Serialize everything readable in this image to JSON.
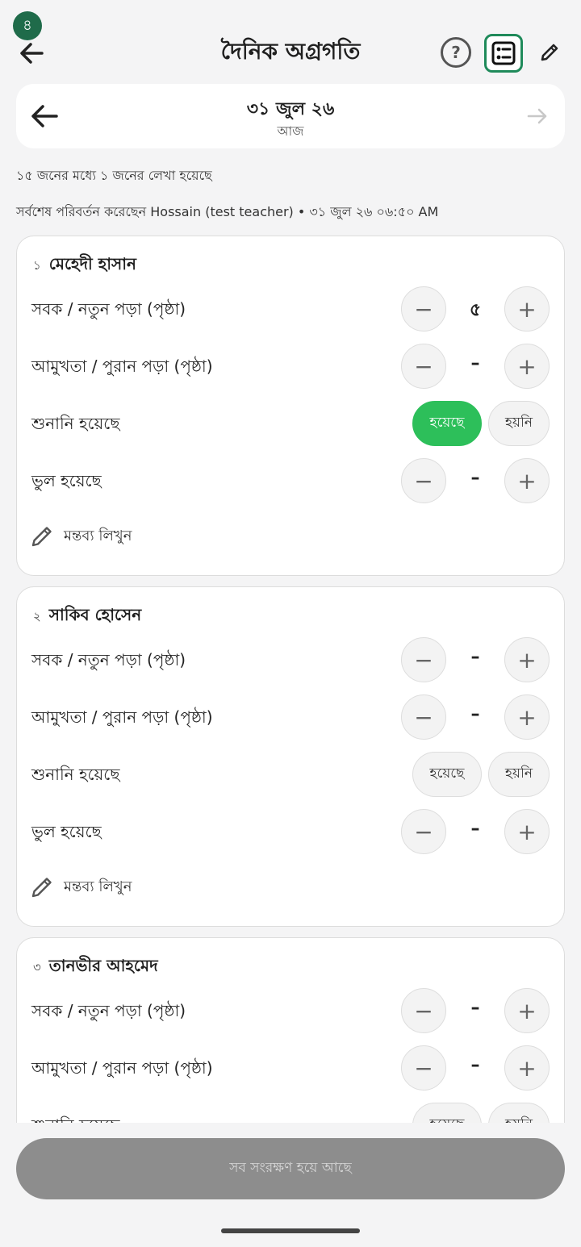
{
  "header": {
    "badge": "৪",
    "title": "দৈনিক অগ্রগতি",
    "help_label": "?"
  },
  "date": {
    "main": "৩১ জুল ২৬",
    "sub": "আজ"
  },
  "summary": "১৫ জনের মধ্যে ১ জনের লেখা হয়েছে",
  "last_modified": "সর্বশেষ পরিবর্তন করেছেন Hossain (test teacher) • ৩১ জুল ২৬ ০৬:৫০ AM",
  "labels": {
    "lesson": "সবক / নতুন পড়া (পৃষ্ঠা)",
    "revision": "আমুখতা / পুরান পড়া (পৃষ্ঠা)",
    "recited": "শুনানি হয়েছে",
    "mistakes": "ভুল হয়েছে",
    "yes": "হয়েছে",
    "no": "হয়নি",
    "comment": "মন্তব্য লিখুন",
    "minus": "−",
    "plus": "+"
  },
  "students": [
    {
      "num": "১",
      "name": "মেহেদী হাসান",
      "lesson": "৫",
      "revision": "–",
      "recited": "yes",
      "mistakes": "–"
    },
    {
      "num": "২",
      "name": "সাকিব হোসেন",
      "lesson": "–",
      "revision": "–",
      "recited": "",
      "mistakes": "–"
    },
    {
      "num": "৩",
      "name": "তানভীর আহমেদ",
      "lesson": "–",
      "revision": "–",
      "recited": "",
      "mistakes": "–"
    }
  ],
  "save_button": "সব সংরক্ষণ হয়ে আছে",
  "colors": {
    "accent": "#2dbf5a",
    "brand": "#1f6b4a",
    "save_disabled": "#8d8d8d"
  }
}
